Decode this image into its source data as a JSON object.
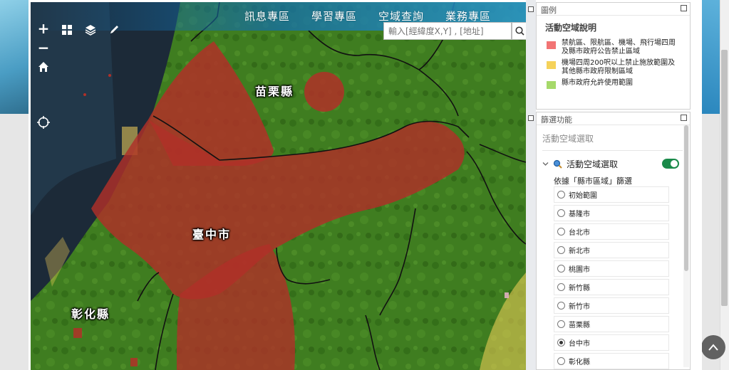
{
  "nav": {
    "items": [
      "訊息專區",
      "學習專區",
      "空域查詢",
      "業務專區"
    ]
  },
  "search": {
    "placeholder": "輸入[經緯度X,Y] , [地址]"
  },
  "map": {
    "counties": [
      "苗栗縣",
      "臺中市",
      "彰化縣"
    ],
    "tools": {
      "zoom_in": "+",
      "zoom_out": "−"
    }
  },
  "legend": {
    "panel_title": "圖例",
    "title": "活動空域說明",
    "items": [
      {
        "label": "禁航區、限航區、機場、飛行場四周及縣市政府公告禁止區域",
        "color": "#f27474"
      },
      {
        "label": "機場四周200呎以上禁止施放範圍及其他縣市政府限制區域",
        "color": "#f5d25a"
      },
      {
        "label": "縣市政府允許使用範圍",
        "color": "#a6d96a"
      }
    ]
  },
  "filter": {
    "panel_title": "篩選功能",
    "subtitle": "活動空域選取",
    "layer_label": "活動空域選取",
    "layer_enabled": true,
    "caption": "依據「縣市區域」篩選",
    "options": [
      "初始範圍",
      "基隆市",
      "台北市",
      "新北市",
      "桃園市",
      "新竹縣",
      "新竹市",
      "苗栗縣",
      "台中市",
      "彰化縣"
    ],
    "selected": "台中市"
  },
  "colors": {
    "accent": "#1a8a4a",
    "restricted": "#b03028",
    "vegetation": "#3d7a1e",
    "header": "#2a86bd"
  }
}
